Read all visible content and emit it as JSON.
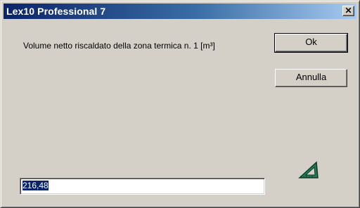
{
  "window": {
    "title": "Lex10 Professional 7",
    "close_symbol": "✕"
  },
  "prompt": {
    "text": "Volume netto riscaldato della zona termica n. 1 [m³]"
  },
  "buttons": {
    "ok_label": "Ok",
    "cancel_label": "Annulla"
  },
  "input": {
    "value": "216,48"
  },
  "icons": {
    "logo": "triangle-set-square-icon"
  },
  "colors": {
    "title_gradient_start": "#0a246a",
    "title_gradient_end": "#a6caf0",
    "face": "#d4d0c8",
    "logo_green": "#1f7a55",
    "selection": "#0a246a"
  }
}
